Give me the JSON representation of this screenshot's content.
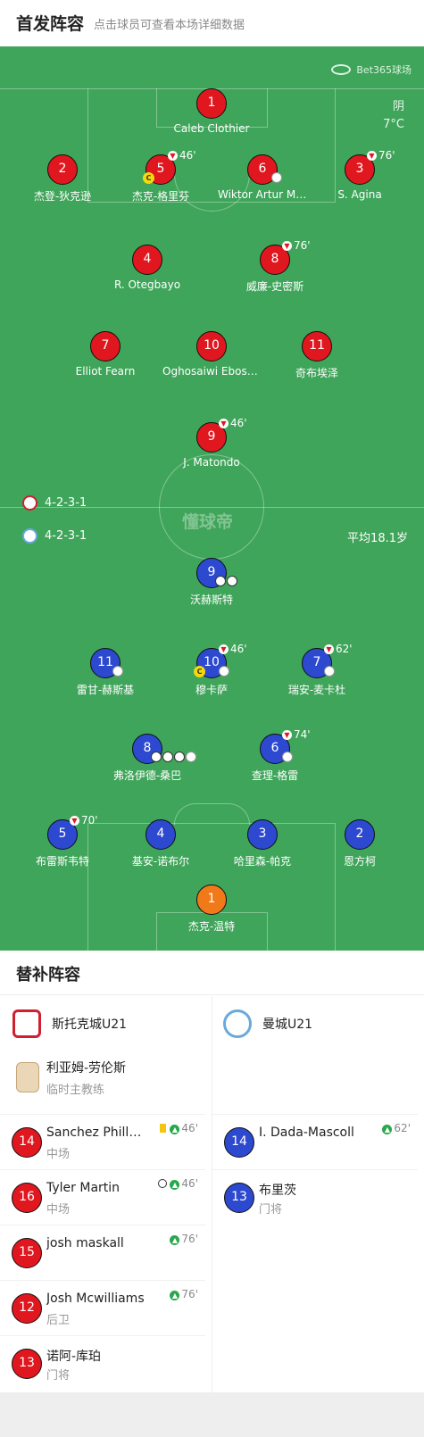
{
  "header": {
    "title": "首发阵容",
    "subtitle": "点击球员可查看本场详细数据"
  },
  "pitch": {
    "sponsor": "Bet365球场",
    "weather": "阴",
    "temperature": "7°C",
    "watermark": "懂球帝",
    "avg_age": "平均18.1岁",
    "home_formation": "4-2-3-1",
    "away_formation": "4-2-3-1"
  },
  "home_players": [
    {
      "number": "1",
      "name": "Caleb Clothier"
    },
    {
      "number": "2",
      "name": "杰登-狄克逊"
    },
    {
      "number": "5",
      "name": "杰克-格里芬",
      "sub_off": "46'",
      "captain": "C"
    },
    {
      "number": "6",
      "name": "Wiktor Artur Marta"
    },
    {
      "number": "3",
      "name": "S. Agina",
      "sub_off": "76'"
    },
    {
      "number": "4",
      "name": "R. Otegbayo"
    },
    {
      "number": "8",
      "name": "威廉-史密斯",
      "sub_off": "76'"
    },
    {
      "number": "7",
      "name": "Elliot Fearn"
    },
    {
      "number": "10",
      "name": "Oghosaiwi Ebosele"
    },
    {
      "number": "11",
      "name": "奇布埃泽"
    },
    {
      "number": "9",
      "name": "J. Matondo",
      "sub_off": "46'"
    }
  ],
  "away_players": [
    {
      "number": "9",
      "name": "沃赫斯特"
    },
    {
      "number": "11",
      "name": "雷甘-赫斯基"
    },
    {
      "number": "10",
      "name": "穆卡萨",
      "sub_off": "46'",
      "captain": "C"
    },
    {
      "number": "7",
      "name": "瑞安-麦卡杜",
      "sub_off": "62'"
    },
    {
      "number": "8",
      "name": "弗洛伊德-桑巴"
    },
    {
      "number": "6",
      "name": "查理-格雷",
      "sub_off": "74'"
    },
    {
      "number": "5",
      "name": "布雷斯韦特",
      "sub_off": "70'"
    },
    {
      "number": "4",
      "name": "基安-诺布尔"
    },
    {
      "number": "3",
      "name": "哈里森-帕克"
    },
    {
      "number": "2",
      "name": "恩方柯"
    },
    {
      "number": "1",
      "name": "杰克-温特"
    }
  ],
  "subs": {
    "title": "替补阵容",
    "home_team": "斯托克城U21",
    "away_team": "曼城U21",
    "coach_name": "利亚姆-劳伦斯",
    "coach_role": "临时主教练",
    "home": [
      {
        "number": "14",
        "name": "Sanchez Phillips",
        "position": "中场",
        "minute": "46'"
      },
      {
        "number": "16",
        "name": "Tyler Martin",
        "position": "中场",
        "minute": "46'"
      },
      {
        "number": "15",
        "name": "josh maskall",
        "position": "",
        "minute": "76'"
      },
      {
        "number": "12",
        "name": "Josh Mcwilliams",
        "position": "后卫",
        "minute": "76'"
      },
      {
        "number": "13",
        "name": "诺阿-库珀",
        "position": "门将",
        "minute": ""
      }
    ],
    "away": [
      {
        "number": "14",
        "name": "I. Dada-Mascoll",
        "position": "",
        "minute": "62'"
      },
      {
        "number": "13",
        "name": "布里茨",
        "position": "门将",
        "minute": ""
      }
    ]
  }
}
